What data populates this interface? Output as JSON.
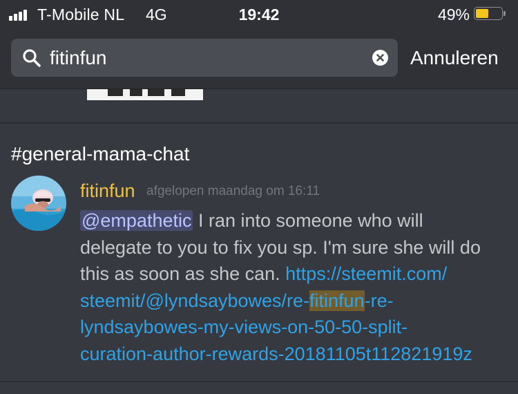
{
  "status_bar": {
    "carrier": "T-Mobile NL",
    "network": "4G",
    "time": "19:42",
    "battery_percent": "49%",
    "battery_level": 0.49
  },
  "search": {
    "query": "fitinfun",
    "cancel_label": "Annuleren"
  },
  "result": {
    "channel": "#general-mama-chat",
    "author": "fitinfun",
    "timestamp": "afgelopen maandag om 16:11",
    "mention": "@empathetic",
    "text_line1": " I ran into someone who will",
    "text_line2": "delegate to you to fix you sp. I'm sure she will do",
    "text_line3": "this as soon as she can. ",
    "link_line3": "https://steemit.com/",
    "link_line4_a": "steemit/@lyndsaybowes/re-",
    "link_line4_b": "fitinfun",
    "link_line4_c": "-re-",
    "link_line5": "lyndsaybowes-my-views-on-50-50-split-",
    "link_line6": "curation-author-rewards-20181105t112821919z"
  },
  "colors": {
    "background": "#36393f",
    "header": "#2f3136",
    "author": "#f0c23c",
    "link": "#2ea3e8",
    "mention_bg": "#474b6e",
    "highlight": "#735c2c"
  }
}
